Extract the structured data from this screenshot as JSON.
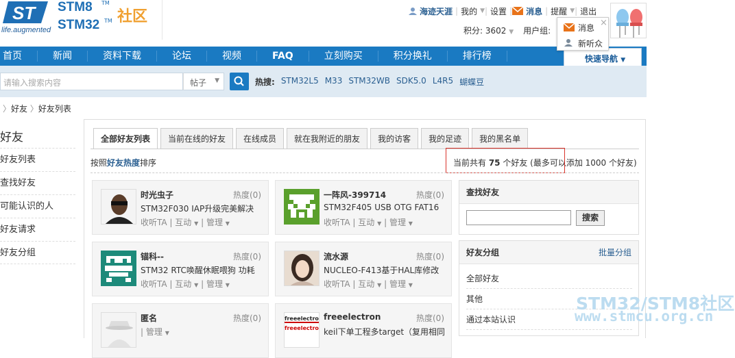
{
  "header": {
    "logo_tagline": "life.augmented",
    "logo_line1": "STM8",
    "logo_line2": "STM32",
    "logo_tm": "TM",
    "logo_cn": "社区",
    "user_name": "海迹天涯",
    "menu_my": "我的",
    "menu_settings": "设置",
    "menu_messages": "消息",
    "menu_remind": "提醒",
    "menu_logout": "退出",
    "points": "积分: 3602",
    "user_group": "用户组:",
    "popup_messages": "消息",
    "popup_new_listeners": "新听众"
  },
  "nav": {
    "items": [
      "首页",
      "新闻",
      "资料下载",
      "论坛",
      "视频",
      "FAQ",
      "立刻购买",
      "积分换礼",
      "排行榜"
    ],
    "quick": "快速导航"
  },
  "search": {
    "placeholder": "请输入搜索内容",
    "type": "帖子",
    "hot_label": "热搜:",
    "hot": [
      "STM32L5",
      "M33",
      "STM32WB",
      "SDK5.0",
      "L4R5",
      "蝴蝶豆"
    ]
  },
  "breadcrumb": {
    "a": "好友",
    "b": "好友列表"
  },
  "sidebar": {
    "title": "好友",
    "items": [
      "好友列表",
      "查找好友",
      "可能认识的人",
      "好友请求",
      "好友分组"
    ]
  },
  "tabs": [
    "全部好友列表",
    "当前在线的好友",
    "在线成员",
    "就在我附近的朋友",
    "我的访客",
    "我的足迹",
    "我的黑名单"
  ],
  "sort": {
    "prefix": "按照",
    "key": "好友热度",
    "suffix": "排序"
  },
  "total": {
    "prefix": "当前共有 ",
    "count": "75",
    "suffix": " 个好友 (最多可以添加 1000 个好友)"
  },
  "friends": [
    {
      "name": "时光虫子",
      "hot": "热度(0)",
      "desc": "STM32F030 IAP升级完美解决",
      "a1": "收听TA",
      "a2": "互动",
      "a3": "管理"
    },
    {
      "name": "一阵风-399714",
      "hot": "热度(0)",
      "desc": "STM32F405 USB OTG FAT16",
      "a1": "收听TA",
      "a2": "互动",
      "a3": "管理"
    },
    {
      "name": "锚科--",
      "hot": "热度(0)",
      "desc": "STM32 RTC唤醒休眠喂狗 功耗",
      "a1": "收听TA",
      "a2": "互动",
      "a3": "管理"
    },
    {
      "name": "流水源",
      "hot": "热度(0)",
      "desc": "NUCLEO-F413基于HAL库修改",
      "a1": "收听TA",
      "a2": "互动",
      "a3": "管理"
    },
    {
      "name": "匿名",
      "hot": "热度(0)",
      "desc": "",
      "a1": "",
      "a2": "",
      "a3": "管理"
    },
    {
      "name": "freeelectron",
      "hot": "热度(0)",
      "desc": "keil下单工程多target（复用相同",
      "a1": "",
      "a2": "",
      "a3": ""
    }
  ],
  "avatar_labels": {
    "freeelectron": "freeelectron"
  },
  "find": {
    "title": "查找好友",
    "button": "搜索"
  },
  "groups": {
    "title": "好友分组",
    "batch": "批量分组",
    "items": [
      "全部好友",
      "其他",
      "通过本站认识"
    ]
  },
  "watermark": {
    "line1": "STM32/STM8社区",
    "line2": "www.stmcu.org.cn"
  },
  "colors": {
    "nav_blue": "#1a7ac2",
    "link_blue": "#2a5f91",
    "highlight_red": "#d9332a"
  }
}
